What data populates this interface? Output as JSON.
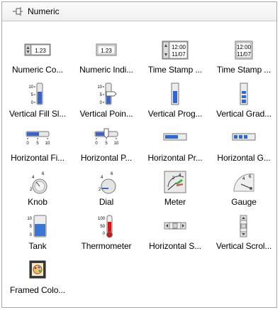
{
  "palette": {
    "title": "Numeric",
    "items": [
      {
        "label": "Numeric Co...",
        "icon": "numeric-control-icon",
        "value": "1.23"
      },
      {
        "label": "Numeric Indi...",
        "icon": "numeric-indicator-icon",
        "value": "1.23"
      },
      {
        "label": "Time Stamp ...",
        "icon": "time-stamp-control-icon",
        "time": "12:00",
        "date": "11/07"
      },
      {
        "label": "Time Stamp ...",
        "icon": "time-stamp-indicator-icon",
        "time": "12:00",
        "date": "11/07"
      },
      {
        "label": "Vertical Fill Sl...",
        "icon": "vertical-fill-slide-icon",
        "ticks": [
          "10",
          "5",
          "0"
        ]
      },
      {
        "label": "Vertical Poin...",
        "icon": "vertical-pointer-slide-icon",
        "ticks": [
          "10",
          "5",
          "0"
        ]
      },
      {
        "label": "Vertical Prog...",
        "icon": "vertical-progress-bar-icon"
      },
      {
        "label": "Vertical Grad...",
        "icon": "vertical-graduated-bar-icon"
      },
      {
        "label": "Horizontal Fi...",
        "icon": "horizontal-fill-slide-icon",
        "ticks": [
          "0",
          "5",
          "10"
        ]
      },
      {
        "label": "Horizontal P...",
        "icon": "horizontal-pointer-slide-icon",
        "ticks": [
          "0",
          "5",
          "10"
        ]
      },
      {
        "label": "Horizontal Pr...",
        "icon": "horizontal-progress-bar-icon"
      },
      {
        "label": "Horizontal G...",
        "icon": "horizontal-graduated-bar-icon"
      },
      {
        "label": "Knob",
        "icon": "knob-icon",
        "ticks": [
          "2",
          "4",
          "6"
        ]
      },
      {
        "label": "Dial",
        "icon": "dial-icon",
        "ticks": [
          "2",
          "4",
          "6"
        ]
      },
      {
        "label": "Meter",
        "icon": "meter-icon",
        "ticks": [
          "2",
          "4"
        ]
      },
      {
        "label": "Gauge",
        "icon": "gauge-icon",
        "ticks": [
          "4",
          "6"
        ]
      },
      {
        "label": "Tank",
        "icon": "tank-icon",
        "ticks": [
          "10",
          "5",
          "0"
        ]
      },
      {
        "label": "Thermometer",
        "icon": "thermometer-icon",
        "ticks": [
          "100",
          "50",
          "0"
        ]
      },
      {
        "label": "Horizontal S...",
        "icon": "horizontal-scrollbar-icon"
      },
      {
        "label": "Vertical Scrol...",
        "icon": "vertical-scrollbar-icon"
      },
      {
        "label": "Framed Colo...",
        "icon": "framed-color-box-icon"
      }
    ]
  }
}
